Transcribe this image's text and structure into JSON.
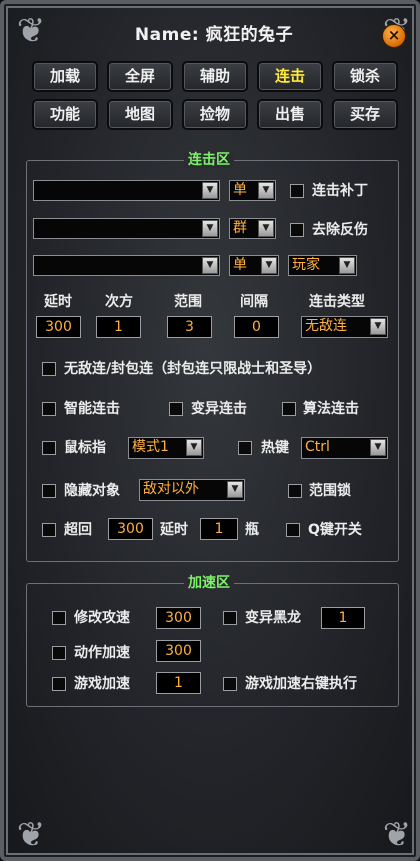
{
  "window": {
    "title": "Name: 疯狂的兔子"
  },
  "tabs_row1": [
    {
      "label": "加载"
    },
    {
      "label": "全屏"
    },
    {
      "label": "辅助"
    },
    {
      "label": "连击"
    },
    {
      "label": "锁杀"
    }
  ],
  "tabs_row2": [
    {
      "label": "功能"
    },
    {
      "label": "地图"
    },
    {
      "label": "捡物"
    },
    {
      "label": "出售"
    },
    {
      "label": "买存"
    }
  ],
  "active_tab": "连击",
  "combo": {
    "group_title": "连击区",
    "skill_selects": [
      "",
      "",
      ""
    ],
    "mode_selects": [
      "单",
      "群",
      "单"
    ],
    "target_select": "玩家",
    "opt_buding": "连击补丁",
    "opt_fanshang": "去除反伤",
    "params": {
      "delay_label": "延时",
      "delay": "300",
      "count_label": "次方",
      "count": "1",
      "range_label": "范围",
      "range": "3",
      "interval_label": "间隔",
      "interval": "0",
      "type_label": "连击类型",
      "type": "无敌连"
    },
    "opt_wudi": "无敌连/封包连（封包连只限战士和圣导）",
    "opt_smart": "智能连击",
    "opt_mutation": "变异连击",
    "opt_algo": "算法连击",
    "opt_mouse": "鼠标指",
    "mouse_mode": "模式1",
    "opt_hotkey": "热键",
    "hotkey_value": "Ctrl",
    "opt_hide": "隐藏对象",
    "hide_value": "敌对以外",
    "opt_range_lock": "范围锁",
    "opt_super": "超回",
    "super_value": "300",
    "super_delay_label": "延时",
    "super_bottle": "1",
    "super_bottle_label": "瓶",
    "opt_q": "Q键开关"
  },
  "speed": {
    "group_title": "加速区",
    "attack_label": "修改攻速",
    "attack_value": "300",
    "dragon_label": "变异黑龙",
    "dragon_value": "1",
    "action_label": "动作加速",
    "action_value": "300",
    "game_label": "游戏加速",
    "game_value": "1",
    "rightkey_label": "游戏加速右键执行"
  }
}
